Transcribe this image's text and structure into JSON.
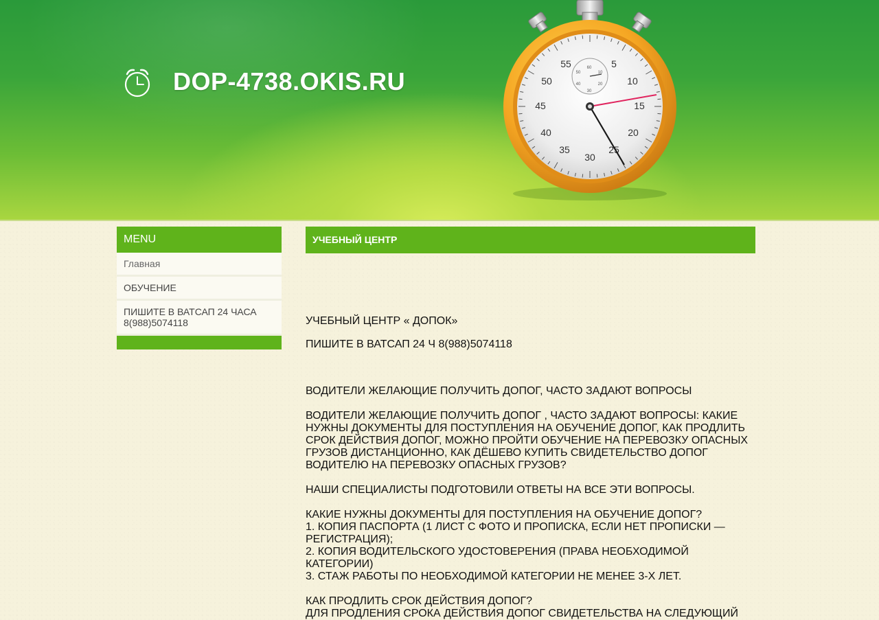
{
  "header": {
    "site_title": "DOP-4738.OKIS.RU",
    "stopwatch_labels": [
      "55",
      "5",
      "50",
      "10",
      "45",
      "15",
      "40",
      "20",
      "35",
      "25",
      "30"
    ],
    "small_dial_labels": [
      "60",
      "10",
      "50",
      "20",
      "40",
      "30"
    ]
  },
  "sidebar": {
    "title": "MENU",
    "items": [
      {
        "label": "Главная"
      },
      {
        "label": "ОБУЧЕНИЕ"
      },
      {
        "label": "ПИШИТЕ В ВАТСАП 24 ЧАСА 8(988)5074118"
      }
    ]
  },
  "content": {
    "heading": "УЧЕБНЫЙ ЦЕНТР",
    "paragraphs": [
      "УЧЕБНЫЙ ЦЕНТР « ДОПОК»",
      "ПИШИТЕ В ВАТСАП 24 Ч  8(988)5074118",
      "ВОДИТЕЛИ ЖЕЛАЮЩИЕ ПОЛУЧИТЬ ДОПОГ, ЧАСТО ЗАДАЮТ ВОПРОСЫ",
      "ВОДИТЕЛИ ЖЕЛАЮЩИЕ ПОЛУЧИТЬ ДОПОГ , ЧАСТО ЗАДАЮТ ВОПРОСЫ: КАКИЕ НУЖНЫ ДОКУМЕНТЫ ДЛЯ ПОСТУПЛЕНИЯ НА ОБУЧЕНИЕ ДОПОГ, КАК ПРОДЛИТЬ СРОК ДЕЙСТВИЯ ДОПОГ, МОЖНО ПРОЙТИ ОБУЧЕНИЕ НА ПЕРЕВОЗКУ ОПАСНЫХ ГРУЗОВ ДИСТАНЦИОННО, КАК ДЁШЕВО КУПИТЬ СВИДЕТЕЛЬСТВО ДОПОГ ВОДИТЕЛЮ НА ПЕРЕВОЗКУ ОПАСНЫХ ГРУЗОВ?",
      "НАШИ СПЕЦИАЛИСТЫ ПОДГОТОВИЛИ ОТВЕТЫ НА ВСЕ ЭТИ ВОПРОСЫ.",
      "КАКИЕ НУЖНЫ ДОКУМЕНТЫ ДЛЯ ПОСТУПЛЕНИЯ НА ОБУЧЕНИЕ ДОПОГ?",
      "1. КОПИЯ ПАСПОРТА (1 ЛИСТ С ФОТО И ПРОПИСКА, ЕСЛИ НЕТ ПРОПИСКИ — РЕГИСТРАЦИЯ);",
      "2. КОПИЯ ВОДИТЕЛЬСКОГО УДОСТОВЕРЕНИЯ (ПРАВА НЕОБХОДИМОЙ КАТЕГОРИИ)",
      "3. СТАЖ РАБОТЫ ПО НЕОБХОДИМОЙ КАТЕГОРИИ НЕ МЕНЕЕ 3-Х ЛЕТ.",
      "КАК ПРОДЛИТЬ СРОК ДЕЙСТВИЯ ДОПОГ?",
      "ДЛЯ ПРОДЛЕНИЯ СРОКА ДЕЙСТВИЯ ДОПОГ СВИДЕТЕЛЬСТВА НА СЛЕДУЮЩИЙ"
    ]
  },
  "colors": {
    "accent_green": "#5fb31b",
    "header_dark_green": "#2a9a3a",
    "background": "#f6f2dc",
    "stopwatch_gold": "#f5a623",
    "second_hand": "#e0245e"
  },
  "icons": {
    "logo": "alarm-clock-icon",
    "hero": "stopwatch-illustration"
  }
}
